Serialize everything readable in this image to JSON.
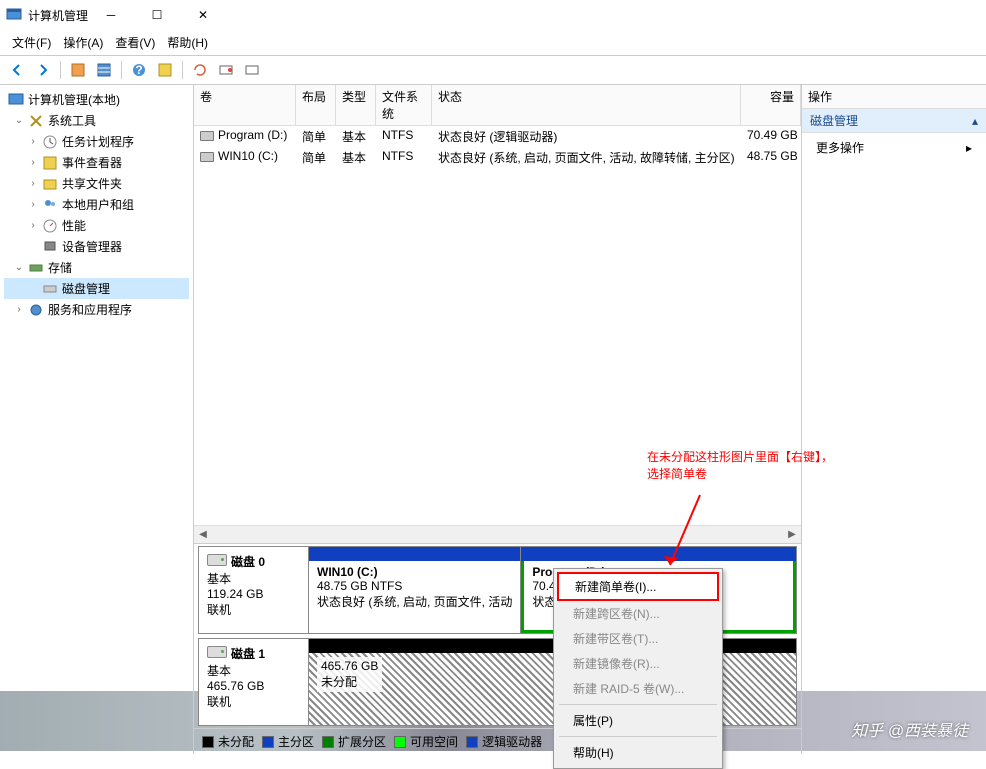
{
  "window": {
    "title": "计算机管理"
  },
  "menu": {
    "file": "文件(F)",
    "action": "操作(A)",
    "view": "查看(V)",
    "help": "帮助(H)"
  },
  "tree": {
    "root": "计算机管理(本地)",
    "sys_tools": "系统工具",
    "task_sched": "任务计划程序",
    "event_viewer": "事件查看器",
    "shared_folders": "共享文件夹",
    "local_users": "本地用户和组",
    "performance": "性能",
    "device_mgr": "设备管理器",
    "storage": "存储",
    "disk_mgmt": "磁盘管理",
    "services_apps": "服务和应用程序"
  },
  "vol_table": {
    "h_volume": "卷",
    "h_layout": "布局",
    "h_type": "类型",
    "h_fs": "文件系统",
    "h_status": "状态",
    "h_capacity": "容量",
    "r1_vol": "Program (D:)",
    "r1_layout": "简单",
    "r1_type": "基本",
    "r1_fs": "NTFS",
    "r1_status": "状态良好 (逻辑驱动器)",
    "r1_cap": "70.49 GB",
    "r2_vol": "WIN10 (C:)",
    "r2_layout": "简单",
    "r2_type": "基本",
    "r2_fs": "NTFS",
    "r2_status": "状态良好 (系统, 启动, 页面文件, 活动, 故障转储, 主分区)",
    "r2_cap": "48.75 GB"
  },
  "disk0": {
    "name": "磁盘 0",
    "type": "基本",
    "size": "119.24 GB",
    "online": "联机",
    "v1_name": "WIN10  (C:)",
    "v1_size": "48.75 GB NTFS",
    "v1_status": "状态良好 (系统, 启动, 页面文件, 活动",
    "v2_name": "Program  (D:)",
    "v2_size": "70.49 GB NTFS",
    "v2_status": "状态良好 (逻辑驱动器)"
  },
  "disk1": {
    "name": "磁盘 1",
    "type": "基本",
    "size": "465.76 GB",
    "online": "联机",
    "v_size": "465.76 GB",
    "v_status": "未分配"
  },
  "legend": {
    "unalloc": "未分配",
    "primary": "主分区",
    "ext": "扩展分区",
    "free": "可用空间",
    "logical": "逻辑驱动器"
  },
  "right": {
    "header": "操作",
    "section": "磁盘管理",
    "more": "更多操作"
  },
  "ctx": {
    "simple": "新建简单卷(I)...",
    "span": "新建跨区卷(N)...",
    "stripe": "新建带区卷(T)...",
    "mirror": "新建镜像卷(R)...",
    "raid5": "新建 RAID-5 卷(W)...",
    "props": "属性(P)",
    "help": "帮助(H)"
  },
  "annotation": {
    "line1": "在未分配这柱形图片里面【右键】，",
    "line2": "选择简单卷"
  },
  "watermark": "知乎 @西装暴徒"
}
